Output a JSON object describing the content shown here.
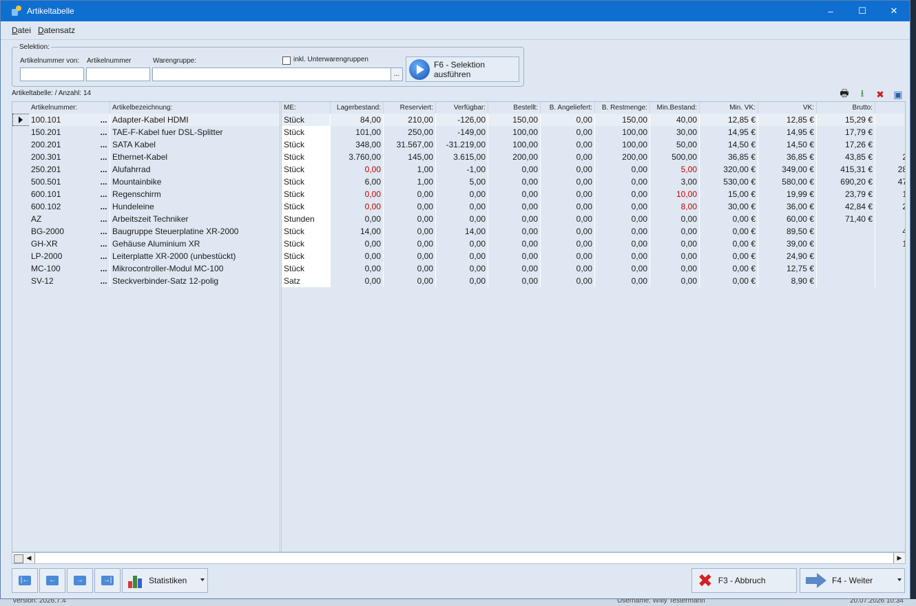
{
  "window": {
    "title": "Artikeltabelle"
  },
  "menu": [
    "Datei",
    "Datensatz"
  ],
  "selection": {
    "legend": "Selektion:",
    "label_from": "Artikelnummer von:",
    "label_to": "Artikelnummer",
    "label_group": "Warengruppe:",
    "value_from": "",
    "value_to": "",
    "value_group": "",
    "ellipsis": "...",
    "checkbox_label": "inkl. Unterwarengruppen",
    "checkbox_checked": false,
    "run_button": "F6 - Selektion\nausführen"
  },
  "table_info": "Artikeltabelle: / Anzahl: 14",
  "toolbar_icons": [
    "print-icon",
    "export-icon",
    "delete-icon",
    "save-icon"
  ],
  "columns": [
    "Artikelnummer:",
    "Artikelbezeichnung:",
    "ME:",
    "Lagerbestand:",
    "Reserviert:",
    "Verfügbar:",
    "Bestellt:",
    "B. Angeliefert:",
    "B. Restmenge:",
    "Min.Bestand:",
    "Min. VK:",
    "VK:",
    "Brutto:"
  ],
  "rows": [
    {
      "nr": "100.101",
      "name": "Adapter-Kabel HDMI",
      "me": "Stück",
      "lager": "84,00",
      "res": "210,00",
      "verf": "-126,00",
      "best": "150,00",
      "ang": "0,00",
      "rest": "150,00",
      "min": "40,00",
      "minvk": "12,85 €",
      "vk": "12,85 €",
      "brutto": "15,29 €",
      "extra": "",
      "lager_red": false,
      "min_red": false
    },
    {
      "nr": "150.201",
      "name": "TAE-F-Kabel fuer DSL-Splitter",
      "me": "Stück",
      "lager": "101,00",
      "res": "250,00",
      "verf": "-149,00",
      "best": "100,00",
      "ang": "0,00",
      "rest": "100,00",
      "min": "30,00",
      "minvk": "14,95 €",
      "vk": "14,95 €",
      "brutto": "17,79 €",
      "extra": "",
      "lager_red": false,
      "min_red": false
    },
    {
      "nr": "200.201",
      "name": "SATA Kabel",
      "me": "Stück",
      "lager": "348,00",
      "res": "31.567,00",
      "verf": "-31.219,00",
      "best": "100,00",
      "ang": "0,00",
      "rest": "100,00",
      "min": "50,00",
      "minvk": "14,50 €",
      "vk": "14,50 €",
      "brutto": "17,26 €",
      "extra": "",
      "lager_red": false,
      "min_red": false
    },
    {
      "nr": "200.301",
      "name": "Ethernet-Kabel",
      "me": "Stück",
      "lager": "3.760,00",
      "res": "145,00",
      "verf": "3.615,00",
      "best": "200,00",
      "ang": "0,00",
      "rest": "200,00",
      "min": "500,00",
      "minvk": "36,85 €",
      "vk": "36,85 €",
      "brutto": "43,85 €",
      "extra": "2",
      "lager_red": false,
      "min_red": false
    },
    {
      "nr": "250.201",
      "name": "Alufahrrad",
      "me": "Stück",
      "lager": "0,00",
      "res": "1,00",
      "verf": "-1,00",
      "best": "0,00",
      "ang": "0,00",
      "rest": "0,00",
      "min": "5,00",
      "minvk": "320,00 €",
      "vk": "349,00 €",
      "brutto": "415,31 €",
      "extra": "28",
      "lager_red": true,
      "min_red": true
    },
    {
      "nr": "500.501",
      "name": "Mountainbike",
      "me": "Stück",
      "lager": "6,00",
      "res": "1,00",
      "verf": "5,00",
      "best": "0,00",
      "ang": "0,00",
      "rest": "0,00",
      "min": "3,00",
      "minvk": "530,00 €",
      "vk": "580,00 €",
      "brutto": "690,20 €",
      "extra": "47",
      "lager_red": false,
      "min_red": false
    },
    {
      "nr": "600.101",
      "name": "Regenschirm",
      "me": "Stück",
      "lager": "0,00",
      "res": "0,00",
      "verf": "0,00",
      "best": "0,00",
      "ang": "0,00",
      "rest": "0,00",
      "min": "10,00",
      "minvk": "15,00 €",
      "vk": "19,99 €",
      "brutto": "23,79 €",
      "extra": "1",
      "lager_red": true,
      "min_red": true
    },
    {
      "nr": "600.102",
      "name": "Hundeleine",
      "me": "Stück",
      "lager": "0,00",
      "res": "0,00",
      "verf": "0,00",
      "best": "0,00",
      "ang": "0,00",
      "rest": "0,00",
      "min": "8,00",
      "minvk": "30,00 €",
      "vk": "36,00 €",
      "brutto": "42,84 €",
      "extra": "2",
      "lager_red": true,
      "min_red": true
    },
    {
      "nr": "AZ",
      "name": "Arbeitszeit Techniker",
      "me": "Stunden",
      "lager": "0,00",
      "res": "0,00",
      "verf": "0,00",
      "best": "0,00",
      "ang": "0,00",
      "rest": "0,00",
      "min": "0,00",
      "minvk": "0,00 €",
      "vk": "60,00 €",
      "brutto": "71,40 €",
      "extra": "",
      "lager_red": false,
      "min_red": false
    },
    {
      "nr": "BG-2000",
      "name": "Baugruppe Steuerplatine XR-2000",
      "me": "Stück",
      "lager": "14,00",
      "res": "0,00",
      "verf": "14,00",
      "best": "0,00",
      "ang": "0,00",
      "rest": "0,00",
      "min": "0,00",
      "minvk": "0,00 €",
      "vk": "89,50 €",
      "brutto": "",
      "extra": "4",
      "lager_red": false,
      "min_red": false
    },
    {
      "nr": "GH-XR",
      "name": "Gehäuse Aluminium XR",
      "me": "Stück",
      "lager": "0,00",
      "res": "0,00",
      "verf": "0,00",
      "best": "0,00",
      "ang": "0,00",
      "rest": "0,00",
      "min": "0,00",
      "minvk": "0,00 €",
      "vk": "39,00 €",
      "brutto": "",
      "extra": "1",
      "lager_red": false,
      "min_red": false
    },
    {
      "nr": "LP-2000",
      "name": "Leiterplatte XR-2000 (unbestückt)",
      "me": "Stück",
      "lager": "0,00",
      "res": "0,00",
      "verf": "0,00",
      "best": "0,00",
      "ang": "0,00",
      "rest": "0,00",
      "min": "0,00",
      "minvk": "0,00 €",
      "vk": "24,90 €",
      "brutto": "",
      "extra": "",
      "lager_red": false,
      "min_red": false
    },
    {
      "nr": "MC-100",
      "name": "Mikrocontroller-Modul MC-100",
      "me": "Stück",
      "lager": "0,00",
      "res": "0,00",
      "verf": "0,00",
      "best": "0,00",
      "ang": "0,00",
      "rest": "0,00",
      "min": "0,00",
      "minvk": "0,00 €",
      "vk": "12,75 €",
      "brutto": "",
      "extra": "",
      "lager_red": false,
      "min_red": false
    },
    {
      "nr": "SV-12",
      "name": "Steckverbinder-Satz 12-polig",
      "me": "Satz",
      "lager": "0,00",
      "res": "0,00",
      "verf": "0,00",
      "best": "0,00",
      "ang": "0,00",
      "rest": "0,00",
      "min": "0,00",
      "minvk": "0,00 €",
      "vk": "8,90 €",
      "brutto": "",
      "extra": "",
      "lager_red": false,
      "min_red": false
    }
  ],
  "row_ellipsis": "...",
  "buttons": {
    "statistics": "Statistiken",
    "cancel": "F3 - Abbruch",
    "next": "F4 - Weiter"
  },
  "status": {
    "version": "Version: 2026.7.4",
    "user": "Username: Willy Testermann",
    "date": "20.07.2026 10:34"
  }
}
